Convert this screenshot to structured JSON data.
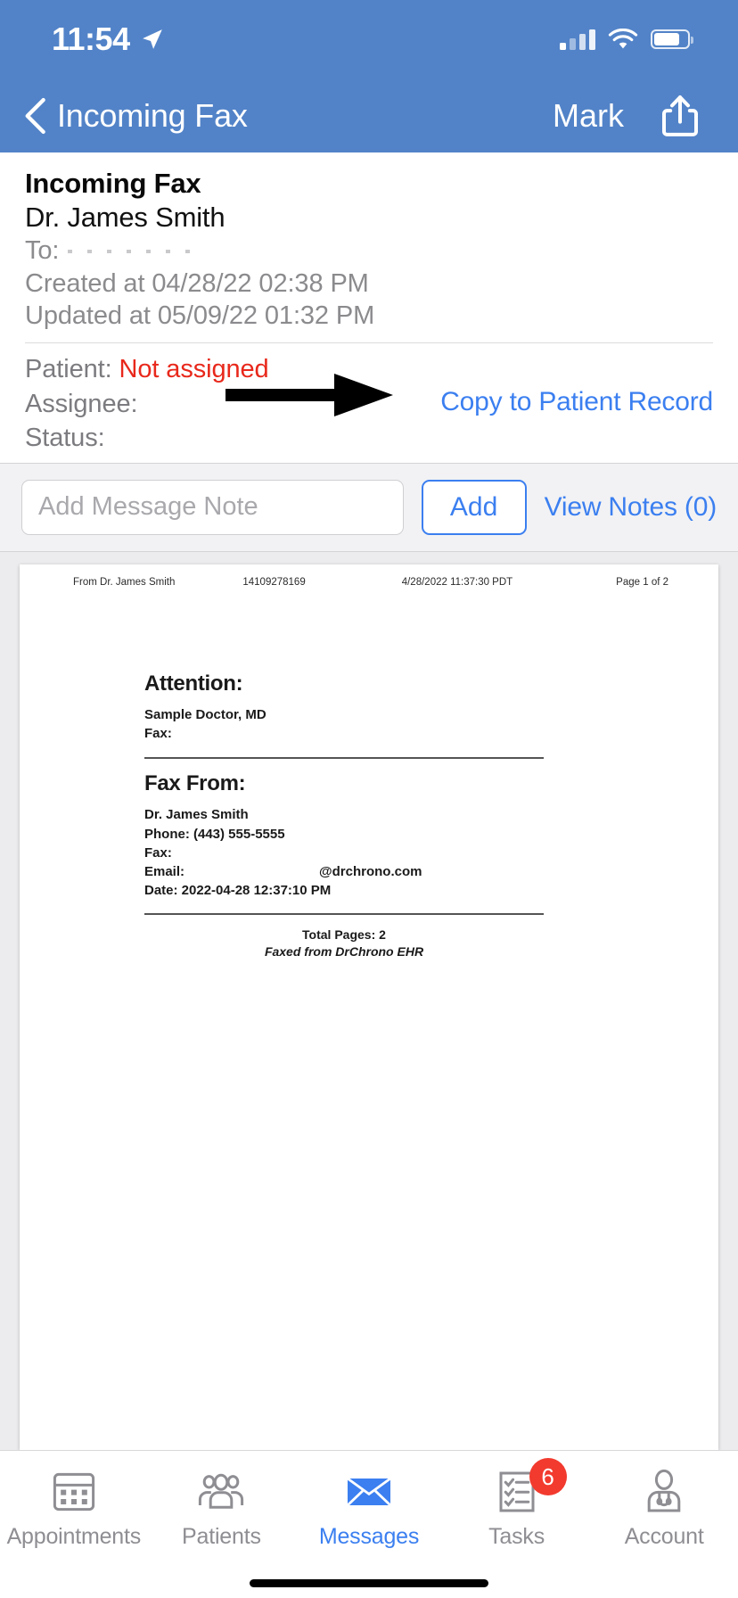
{
  "status_bar": {
    "time": "11:54",
    "location_icon": "location-arrow-icon",
    "signal_icon": "cellular-signal-icon",
    "wifi_icon": "wifi-icon",
    "battery_icon": "battery-icon"
  },
  "nav_bar": {
    "back_icon": "chevron-left-icon",
    "title": "Incoming Fax",
    "mark_label": "Mark",
    "share_icon": "share-icon",
    "background": "#5283c8"
  },
  "detail": {
    "title": "Incoming Fax",
    "sender": "Dr. James Smith",
    "to_label": "To:",
    "to_value": "",
    "created": "Created at 04/28/22 02:38 PM",
    "updated": "Updated at 05/09/22 01:32 PM",
    "patient_label": "Patient:",
    "patient_value": "Not assigned",
    "patient_value_color": "#e8281b",
    "assignee_label": "Assignee:",
    "assignee_value": "",
    "status_label": "Status:",
    "status_value": "",
    "copy_link": "Copy to Patient Record",
    "copy_link_color": "#3b7ff0",
    "annotation_arrow": "black-arrow-annotation"
  },
  "note_bar": {
    "placeholder": "Add Message Note",
    "value": "",
    "add_label": "Add",
    "view_notes_label": "View Notes (0)"
  },
  "document": {
    "header": {
      "from": "From Dr. James Smith",
      "fax_number": "14109278169",
      "timestamp": "4/28/2022 11:37:30 PDT",
      "page": "Page 1 of 2"
    },
    "attention_heading": "Attention:",
    "attention_name": "Sample Doctor, MD",
    "attention_fax_label": "Fax:",
    "attention_fax_value": "",
    "from_heading": "Fax From:",
    "from_name": "Dr. James Smith",
    "from_phone": "Phone: (443) 555-5555",
    "from_fax_label": "Fax:",
    "from_fax_value": "",
    "from_email_label": "Email:",
    "from_email_value": "@drchrono.com",
    "from_date": "Date: 2022-04-28 12:37:10 PM",
    "total_pages": "Total Pages: 2",
    "faxed_from": "Faxed from DrChrono EHR"
  },
  "tab_bar": {
    "items": [
      {
        "label": "Appointments",
        "icon": "calendar-icon",
        "active": false
      },
      {
        "label": "Patients",
        "icon": "people-icon",
        "active": false
      },
      {
        "label": "Messages",
        "icon": "envelope-icon",
        "active": true
      },
      {
        "label": "Tasks",
        "icon": "checklist-icon",
        "active": false,
        "badge": "6"
      },
      {
        "label": "Account",
        "icon": "account-person-icon",
        "active": false
      }
    ],
    "active_color": "#3b7ff0",
    "inactive_color": "#8e8e93",
    "badge_color": "#f23a2e"
  }
}
